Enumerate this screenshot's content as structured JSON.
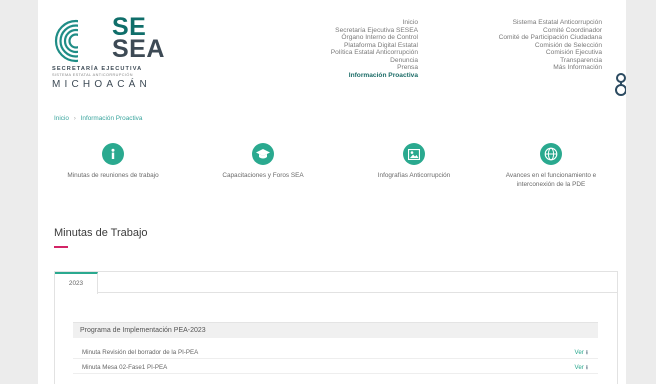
{
  "logo": {
    "word_top": "SE",
    "word_bottom": "SEA",
    "line1": "SECRETARÍA EJECUTIVA",
    "line2": "SISTEMA ESTATAL ANTICORRUPCIÓN",
    "line3": "MICHOACÁN"
  },
  "nav_left": [
    "Inicio",
    "Secretaría Ejecutiva SESEA",
    "Órgano Interno de Control",
    "Plataforma Digital Estatal",
    "Política Estatal Anticorrupción",
    "Denuncia",
    "Prensa",
    "Información Proactiva"
  ],
  "nav_right": [
    "Sistema Estatal Anticorrupción",
    "Comité Coordinador",
    "Comité de Participación Ciudadana",
    "Comisión de Selección",
    "Comisión Ejecutiva",
    "Transparencia",
    "Más Información"
  ],
  "breadcrumb": {
    "home": "Inicio",
    "separator": "›",
    "current": "Información Proactiva"
  },
  "quick_links": [
    {
      "label": "Minutas de reuniones de trabajo",
      "icon": "info-icon"
    },
    {
      "label": "Capacitaciones y Foros SEA",
      "icon": "graduation-cap-icon"
    },
    {
      "label": "Infografías Anticorrupción",
      "icon": "image-icon"
    },
    {
      "label": "Avances en el funcionamiento e interconexión de la PDE",
      "icon": "network-icon"
    }
  ],
  "section_title": "Minutas de Trabajo",
  "tabs": [
    "2023"
  ],
  "program_title": "Programa de Implementación PEA-2023",
  "minutes": [
    {
      "label": "Minuta Revisión del borrador de la PI-PEA",
      "action": "Ver"
    },
    {
      "label": "Minuta Mesa 02-Fase1 PI-PEA",
      "action": "Ver"
    }
  ],
  "colors": {
    "accent": "#2aa98f",
    "brand_dark": "#1d6d68",
    "underline": "#d32466"
  }
}
